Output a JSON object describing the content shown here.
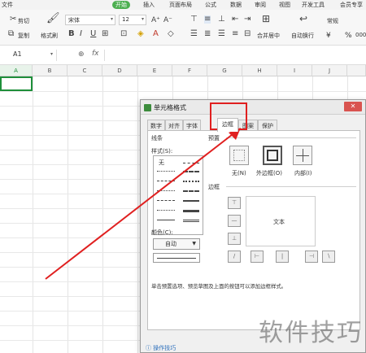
{
  "menubar": {
    "items": [
      "文件",
      "开始",
      "插入",
      "页面布局",
      "公式",
      "数据",
      "审阅",
      "视图",
      "开发工具",
      "会员专享"
    ],
    "active": "开始"
  },
  "toolbar": {
    "cut": "剪切",
    "copy": "复制",
    "format_painter": "格式刷",
    "font_name": "宋体",
    "font_size": "12",
    "merge_center": "合并居中",
    "wrap_text": "自动换行",
    "general": "常规",
    "currency": "¥",
    "percent": "%",
    "thousands": "000"
  },
  "formula_bar": {
    "name_box": "A1",
    "fx": "fx"
  },
  "grid": {
    "columns": [
      "A",
      "B",
      "C",
      "D",
      "E",
      "F",
      "G",
      "H",
      "I",
      "J"
    ]
  },
  "dialog": {
    "title": "单元格格式",
    "close": "✕",
    "tabs": [
      "数字",
      "对齐",
      "字体",
      "边框",
      "图案",
      "保护"
    ],
    "active_tab": "边框",
    "line_group": "线条",
    "style_label": "样式(S):",
    "style_none": "无",
    "color_label": "颜色(C):",
    "color_value": "自动",
    "preset_group": "预置",
    "preset_none": "无(N)",
    "preset_outline": "外边框(O)",
    "preset_inside": "内部(I)",
    "border_group": "边框",
    "preview_text": "文本",
    "hint": "单击预置选项、预览草图及上面的按钮可以添加边框样式。",
    "tips_link": "操作技巧"
  },
  "watermark": "软件技巧",
  "colors": {
    "accent": "#1e8f3a",
    "highlight": "#e02020"
  }
}
